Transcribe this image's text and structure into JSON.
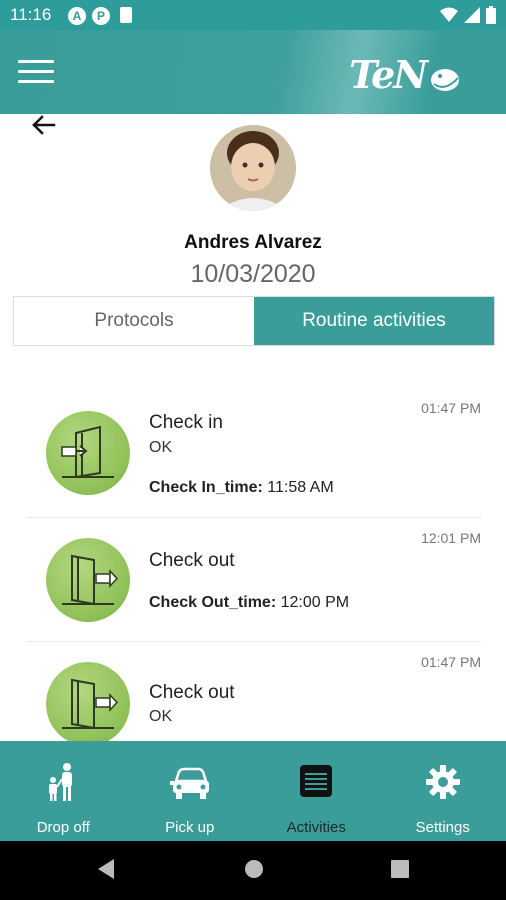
{
  "status_bar": {
    "time": "11:16",
    "badge_a": "A",
    "badge_p": "P"
  },
  "header": {
    "logo_text": "TeN",
    "menu_icon": "hamburger-icon"
  },
  "profile": {
    "name": "Andres Alvarez",
    "date": "10/03/2020"
  },
  "tabs": [
    {
      "label": "Protocols",
      "active": false
    },
    {
      "label": "Routine activities",
      "active": true
    }
  ],
  "activities": [
    {
      "time": "01:47 PM",
      "title": "Check in",
      "status": "OK",
      "detail_label": "Check In_time:",
      "detail_value": " 11:58 AM",
      "icon": "door-enter-icon"
    },
    {
      "time": "12:01 PM",
      "title": "Check out",
      "status": "",
      "detail_label": "Check Out_time:",
      "detail_value": " 12:00 PM",
      "icon": "door-exit-icon"
    },
    {
      "time": "01:47 PM",
      "title": "Check out",
      "status": "OK",
      "detail_label": "",
      "detail_value": "",
      "icon": "door-exit-icon"
    }
  ],
  "bottom_nav": [
    {
      "label": "Drop off",
      "icon": "family-icon",
      "active": false
    },
    {
      "label": "Pick up",
      "icon": "car-icon",
      "active": false
    },
    {
      "label": "Activities",
      "icon": "list-icon",
      "active": true
    },
    {
      "label": "Settings",
      "icon": "gear-icon",
      "active": false
    }
  ],
  "colors": {
    "teal": "#3a9d9a",
    "green": "#8fc057"
  }
}
